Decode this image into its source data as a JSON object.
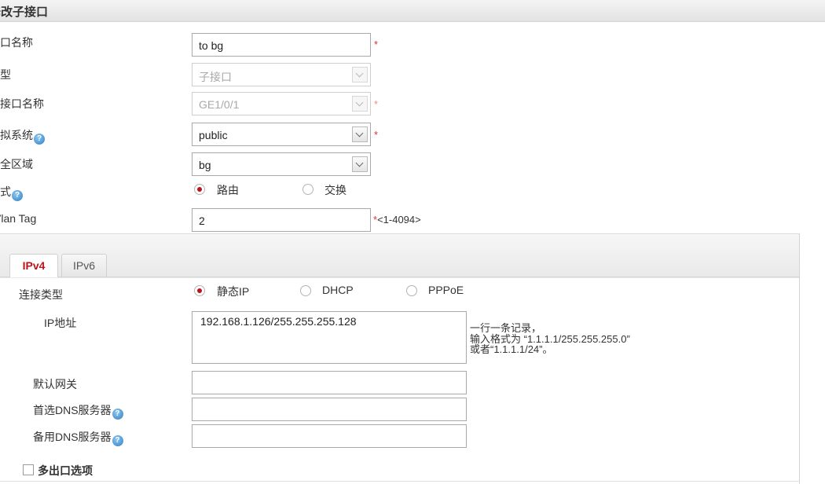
{
  "page": {
    "title": "修改子接口"
  },
  "form": {
    "interface_name": {
      "label": "接口名称",
      "value": "to bg",
      "required": "*"
    },
    "type": {
      "label": "类型",
      "value": "子接口"
    },
    "main_interface": {
      "label": "主接口名称",
      "value": "GE1/0/1",
      "required": "*"
    },
    "virtual_system": {
      "label": "虚拟系统",
      "value": "public",
      "required": "*",
      "help": "?"
    },
    "security_zone": {
      "label": "安全区域",
      "value": "bg"
    },
    "mode": {
      "label": "模式",
      "help": "?",
      "options": [
        {
          "label": "路由",
          "selected": true
        },
        {
          "label": "交换",
          "selected": false
        }
      ]
    },
    "vlan_tag": {
      "label": "Vlan Tag",
      "value": "2",
      "required": "*",
      "range": "<1-4094>"
    }
  },
  "tabs": [
    {
      "label": "IPv4",
      "active": true
    },
    {
      "label": "IPv6",
      "active": false
    }
  ],
  "ipv4": {
    "connection_type": {
      "label": "连接类型",
      "options": [
        {
          "label": "静态IP",
          "selected": true
        },
        {
          "label": "DHCP",
          "selected": false
        },
        {
          "label": "PPPoE",
          "selected": false
        }
      ]
    },
    "ip_address": {
      "label": "IP地址",
      "value": "192.168.1.126/255.255.255.128",
      "hint": [
        "一行一条记录，",
        "输入格式为 “1.1.1.1/255.255.255.0”",
        "或者“1.1.1.1/24”。"
      ]
    },
    "default_gateway": {
      "label": "默认网关",
      "value": ""
    },
    "primary_dns": {
      "label": "首选DNS服务器",
      "value": "",
      "help": "?"
    },
    "secondary_dns": {
      "label": "备用DNS服务器",
      "value": "",
      "help": "?"
    },
    "multi_exit": {
      "label": "多出口选项",
      "checked": false
    }
  },
  "colors": {
    "accent_red": "#c0121b",
    "required_star": "#e0302f",
    "help_icon": "#2f7fc4"
  }
}
